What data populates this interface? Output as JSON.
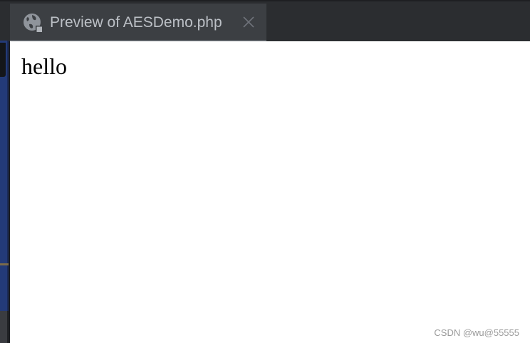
{
  "tab": {
    "title": "Preview of AESDemo.php",
    "icon": "globe-icon",
    "close_icon": "close-icon"
  },
  "content": {
    "text": "hello"
  },
  "watermark": {
    "text": "CSDN @wu@55555"
  },
  "colors": {
    "tabbar_bg": "#2b2d30",
    "active_tab_bg": "#3c3f43",
    "tab_text": "#bcc0c6",
    "content_bg": "#ffffff",
    "sidebar_blue": "#233a78"
  }
}
